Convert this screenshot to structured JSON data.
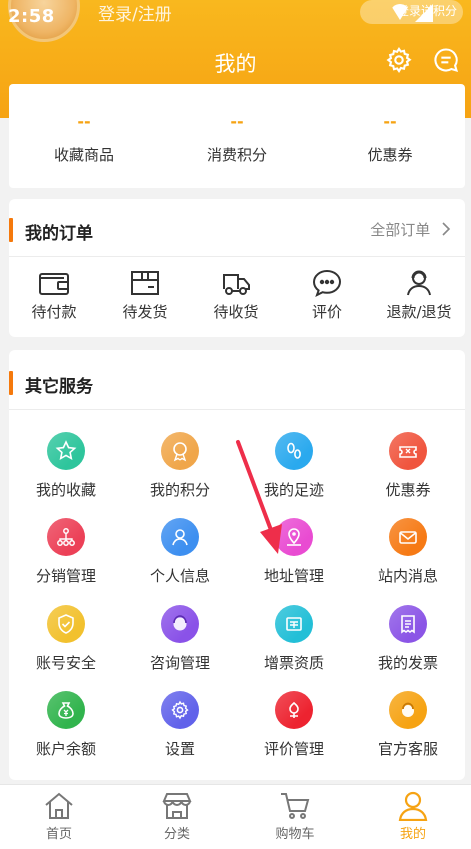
{
  "status_bar": {
    "time": "2:58"
  },
  "header": {
    "login_text": "登录/注册",
    "signin_text": "登录送积分",
    "title": "我的",
    "accent_color": "#f6a313"
  },
  "stats": [
    {
      "value": "--",
      "label": "收藏商品"
    },
    {
      "value": "--",
      "label": "消费积分"
    },
    {
      "value": "--",
      "label": "优惠券"
    }
  ],
  "orders": {
    "title": "我的订单",
    "all_link": "全部订单",
    "items": [
      {
        "label": "待付款",
        "icon": "wallet-icon"
      },
      {
        "label": "待发货",
        "icon": "package-icon"
      },
      {
        "label": "待收货",
        "icon": "truck-icon"
      },
      {
        "label": "评价",
        "icon": "comment-icon"
      },
      {
        "label": "退款/退货",
        "icon": "refund-icon"
      }
    ]
  },
  "services": {
    "title": "其它服务",
    "items": [
      {
        "label": "我的收藏",
        "icon": "star-icon",
        "color": "#2ec59c"
      },
      {
        "label": "我的积分",
        "icon": "medal-icon",
        "color": "#f0a64a"
      },
      {
        "label": "我的足迹",
        "icon": "footprint-icon",
        "color": "#2aa9ee"
      },
      {
        "label": "优惠券",
        "icon": "coupon-icon",
        "color": "#f0553e"
      },
      {
        "label": "分销管理",
        "icon": "network-icon",
        "color": "#ec4057"
      },
      {
        "label": "个人信息",
        "icon": "user-icon",
        "color": "#3d8ff0"
      },
      {
        "label": "地址管理",
        "icon": "location-icon",
        "color": "#e94bd2"
      },
      {
        "label": "站内消息",
        "icon": "mail-icon",
        "color": "#f67a15"
      },
      {
        "label": "账号安全",
        "icon": "shield-icon",
        "color": "#f2c12e"
      },
      {
        "label": "咨询管理",
        "icon": "consult-icon",
        "color": "#8a52e8"
      },
      {
        "label": "增票资质",
        "icon": "invoice-icon",
        "color": "#23bfd7"
      },
      {
        "label": "我的发票",
        "icon": "receipt-icon",
        "color": "#8b55e6"
      },
      {
        "label": "账户余额",
        "icon": "money-bag-icon",
        "color": "#31b44d"
      },
      {
        "label": "设置",
        "icon": "gear-icon",
        "color": "#6162ea"
      },
      {
        "label": "评价管理",
        "icon": "flower-icon",
        "color": "#ed2330"
      },
      {
        "label": "官方客服",
        "icon": "service-icon",
        "color": "#f6a313"
      }
    ]
  },
  "bottom_nav": [
    {
      "label": "首页",
      "icon": "home-icon"
    },
    {
      "label": "分类",
      "icon": "store-icon"
    },
    {
      "label": "购物车",
      "icon": "cart-icon"
    },
    {
      "label": "我的",
      "icon": "profile-icon",
      "active": true
    }
  ]
}
